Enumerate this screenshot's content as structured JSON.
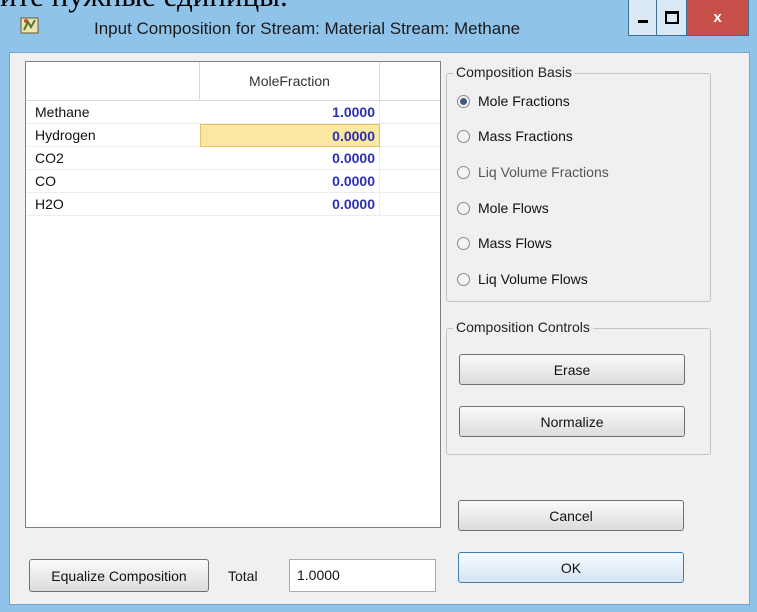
{
  "doc_fragment": "ите нужные единицы.",
  "window": {
    "title": "Input Composition for Stream: Material Stream: Methane",
    "close_label": "x"
  },
  "grid": {
    "column_header": "MoleFraction",
    "rows": [
      {
        "name": "Methane",
        "value": "1.0000"
      },
      {
        "name": "Hydrogen",
        "value": "0.0000"
      },
      {
        "name": "CO2",
        "value": "0.0000"
      },
      {
        "name": "CO",
        "value": "0.0000"
      },
      {
        "name": "H2O",
        "value": "0.0000"
      }
    ],
    "selected_row": 1
  },
  "composition_basis": {
    "title": "Composition Basis",
    "options": [
      "Mole Fractions",
      "Mass Fractions",
      "Liq Volume Fractions",
      "Mole Flows",
      "Mass Flows",
      "Liq Volume Flows"
    ],
    "selected": "Mole Fractions",
    "disabled": [
      "Liq Volume Fractions"
    ]
  },
  "composition_controls": {
    "title": "Composition Controls",
    "erase_label": "Erase",
    "normalize_label": "Normalize"
  },
  "buttons": {
    "cancel_label": "Cancel",
    "ok_label": "OK",
    "equalize_label": "Equalize Composition"
  },
  "total": {
    "label": "Total",
    "value": "1.0000"
  },
  "colors": {
    "value_text": "#2b2fb6",
    "selected_cell": "#fae8a0",
    "window_frame": "#8fc3ea",
    "close_button": "#c7504b"
  },
  "icons": {
    "app": "flowsheet-app-icon",
    "minimize": "minimize-icon",
    "maximize": "maximize-icon",
    "close": "close-icon"
  }
}
